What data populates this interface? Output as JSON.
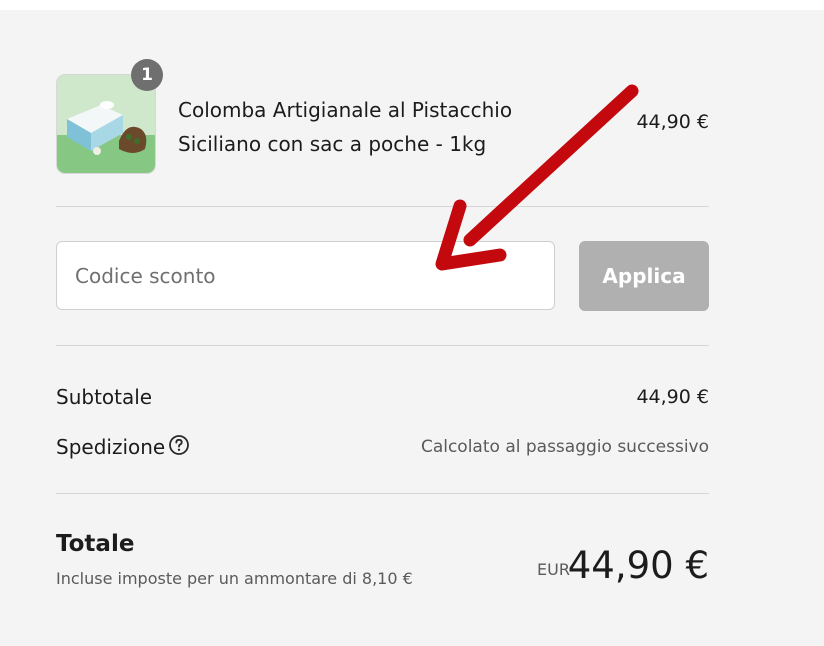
{
  "product": {
    "quantity": "1",
    "title_line1": "Colomba Artigianale al Pistacchio",
    "title_line2": "Siciliano con sac a poche - 1kg",
    "price": "44,90 €"
  },
  "discount": {
    "placeholder": "Codice sconto",
    "value": "",
    "apply_label": "Applica"
  },
  "summary": {
    "subtotal_label": "Subtotale",
    "subtotal_value": "44,90 €",
    "shipping_label": "Spedizione",
    "shipping_value": "Calcolato al passaggio successivo"
  },
  "total": {
    "label": "Totale",
    "tax_note": "Incluse imposte per un ammontare di 8,10 €",
    "currency": "EUR",
    "amount": "44,90 €"
  },
  "icons": {
    "help": "question-circle-icon",
    "annotation": "red-arrow-icon"
  },
  "colors": {
    "panel_bg": "#f4f4f4",
    "apply_button_bg": "#b0b0b0",
    "annotation_arrow": "#c4090e"
  }
}
